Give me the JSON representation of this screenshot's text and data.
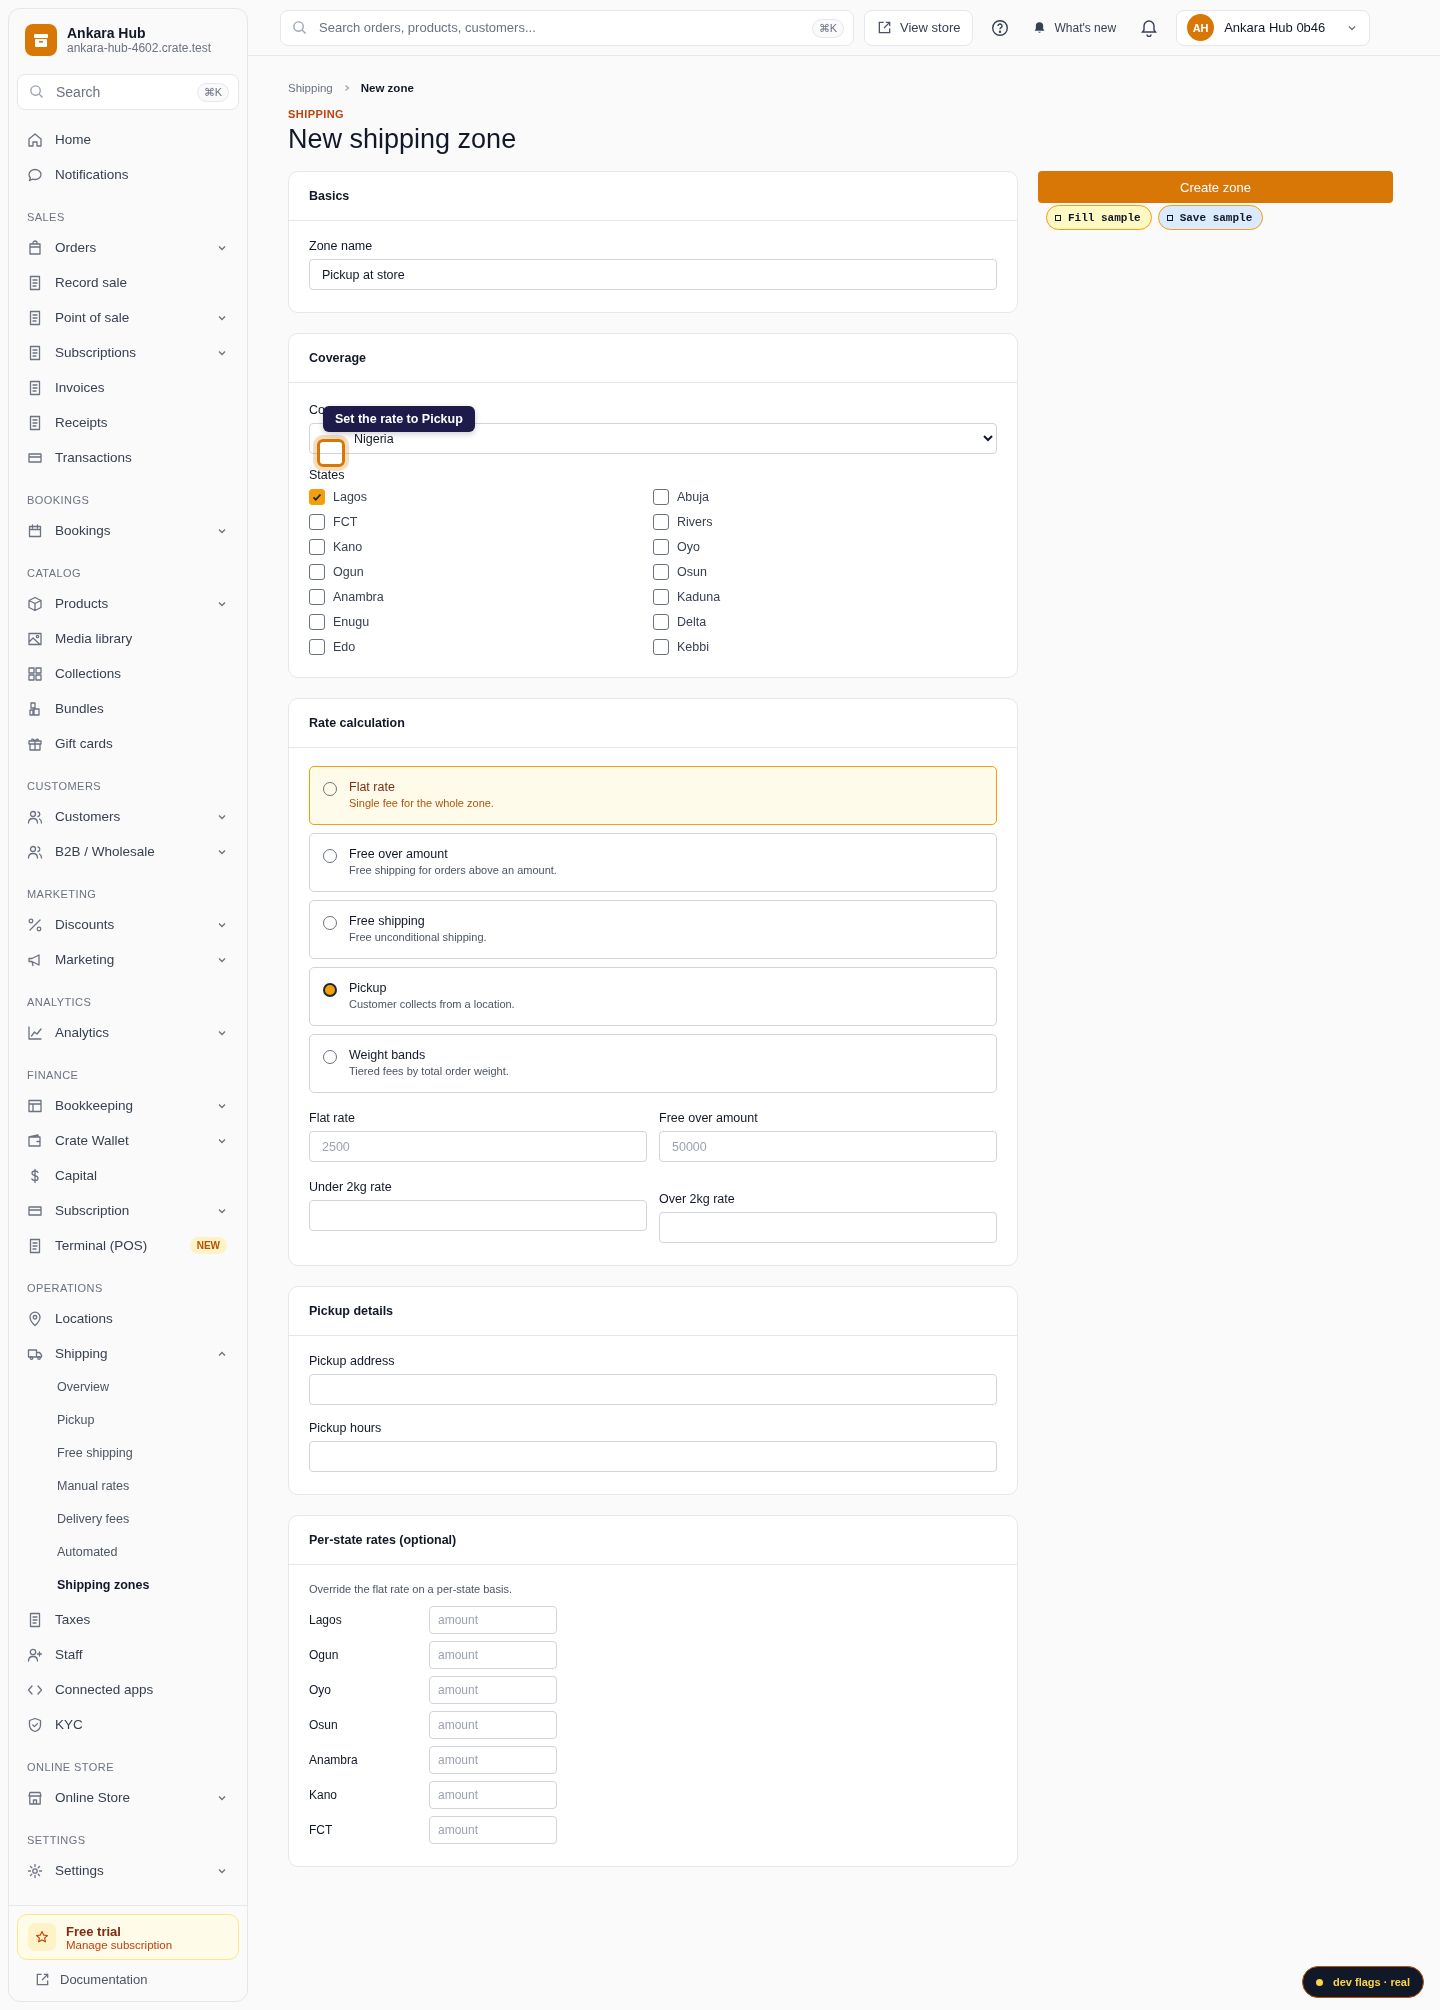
{
  "brand": {
    "name": "Ankara Hub",
    "domain": "ankara-hub-4602.crate.test"
  },
  "sidebar_search": {
    "placeholder": "Search",
    "shortcut": "⌘K"
  },
  "sidebar": {
    "sections": [
      {
        "items": [
          {
            "label": "Home",
            "expandable": false
          },
          {
            "label": "Notifications",
            "expandable": false
          }
        ]
      },
      {
        "title": "SALES",
        "items": [
          {
            "label": "Orders",
            "expandable": true
          },
          {
            "label": "Record sale",
            "expandable": false
          },
          {
            "label": "Point of sale",
            "expandable": true
          },
          {
            "label": "Subscriptions",
            "expandable": true
          },
          {
            "label": "Invoices",
            "expandable": false
          },
          {
            "label": "Receipts",
            "expandable": false
          },
          {
            "label": "Transactions",
            "expandable": false
          }
        ]
      },
      {
        "title": "BOOKINGS",
        "items": [
          {
            "label": "Bookings",
            "expandable": true
          }
        ]
      },
      {
        "title": "CATALOG",
        "items": [
          {
            "label": "Products",
            "expandable": true
          },
          {
            "label": "Media library",
            "expandable": false
          },
          {
            "label": "Collections",
            "expandable": false
          },
          {
            "label": "Bundles",
            "expandable": false
          },
          {
            "label": "Gift cards",
            "expandable": false
          }
        ]
      },
      {
        "title": "CUSTOMERS",
        "items": [
          {
            "label": "Customers",
            "expandable": true
          },
          {
            "label": "B2B / Wholesale",
            "expandable": true
          }
        ]
      },
      {
        "title": "MARKETING",
        "items": [
          {
            "label": "Discounts",
            "expandable": true
          },
          {
            "label": "Marketing",
            "expandable": true
          }
        ]
      },
      {
        "title": "ANALYTICS",
        "items": [
          {
            "label": "Analytics",
            "expandable": true
          }
        ]
      },
      {
        "title": "FINANCE",
        "items": [
          {
            "label": "Bookkeeping",
            "expandable": true
          },
          {
            "label": "Crate Wallet",
            "expandable": true
          },
          {
            "label": "Capital",
            "expandable": false
          },
          {
            "label": "Subscription",
            "expandable": true
          },
          {
            "label": "Terminal (POS)",
            "expandable": false,
            "badge": "NEW"
          }
        ]
      },
      {
        "title": "OPERATIONS",
        "items": [
          {
            "label": "Locations",
            "expandable": false
          },
          {
            "label": "Shipping",
            "expandable": true,
            "expanded": true,
            "children": [
              {
                "label": "Overview",
                "selected": false
              },
              {
                "label": "Pickup",
                "selected": false
              },
              {
                "label": "Free shipping",
                "selected": false
              },
              {
                "label": "Manual rates",
                "selected": false
              },
              {
                "label": "Delivery fees",
                "selected": false
              },
              {
                "label": "Automated",
                "selected": false
              },
              {
                "label": "Shipping zones",
                "selected": true
              }
            ]
          },
          {
            "label": "Taxes",
            "expandable": false
          },
          {
            "label": "Staff",
            "expandable": false
          },
          {
            "label": "Connected apps",
            "expandable": false
          },
          {
            "label": "KYC",
            "expandable": false
          }
        ]
      },
      {
        "title": "ONLINE STORE",
        "items": [
          {
            "label": "Online Store",
            "expandable": true
          }
        ]
      },
      {
        "title": "SETTINGS",
        "items": [
          {
            "label": "Settings",
            "expandable": true
          }
        ]
      }
    ]
  },
  "trial": {
    "title": "Free trial",
    "link": "Manage subscription"
  },
  "docs_link": "Documentation",
  "topbar": {
    "search_placeholder": "Search orders, products, customers...",
    "shortcut": "⌘K",
    "view_store": "View store",
    "whats_new": "What's new",
    "account": {
      "initials": "AH",
      "name": "Ankara Hub 0b46"
    }
  },
  "breadcrumbs": [
    "Shipping",
    "New zone"
  ],
  "eyebrow": "SHIPPING",
  "title": "New shipping zone",
  "basics": {
    "title": "Basics",
    "zone_name_label": "Zone name",
    "zone_name": "Pickup at store"
  },
  "coverage": {
    "title": "Coverage",
    "country_label": "Co",
    "country": "Nigeria",
    "states_label": "States",
    "states": [
      {
        "label": "Lagos",
        "checked": true
      },
      {
        "label": "Abuja",
        "checked": false
      },
      {
        "label": "FCT",
        "checked": false
      },
      {
        "label": "Rivers",
        "checked": false
      },
      {
        "label": "Kano",
        "checked": false
      },
      {
        "label": "Oyo",
        "checked": false
      },
      {
        "label": "Ogun",
        "checked": false
      },
      {
        "label": "Osun",
        "checked": false
      },
      {
        "label": "Anambra",
        "checked": false
      },
      {
        "label": "Kaduna",
        "checked": false
      },
      {
        "label": "Enugu",
        "checked": false
      },
      {
        "label": "Delta",
        "checked": false
      },
      {
        "label": "Edo",
        "checked": false
      },
      {
        "label": "Kebbi",
        "checked": false
      }
    ]
  },
  "tooltip": "Set the rate to Pickup",
  "rate_calculation": {
    "title": "Rate calculation",
    "options": [
      {
        "title": "Flat rate",
        "description": "Single fee for the whole zone.",
        "selected": false,
        "highlighted": true
      },
      {
        "title": "Free over amount",
        "description": "Free shipping for orders above an amount.",
        "selected": false,
        "highlighted": false
      },
      {
        "title": "Free shipping",
        "description": "Free unconditional shipping.",
        "selected": false,
        "highlighted": false
      },
      {
        "title": "Pickup",
        "description": "Customer collects from a location.",
        "selected": true,
        "highlighted": false
      },
      {
        "title": "Weight bands",
        "description": "Tiered fees by total order weight.",
        "selected": false,
        "highlighted": false
      }
    ],
    "fields": [
      {
        "label": "Flat rate",
        "placeholder": "2500"
      },
      {
        "label": "Free over amount",
        "placeholder": "50000"
      },
      {
        "label": "Under 2kg rate"
      },
      {
        "label": "Over 2kg rate"
      }
    ]
  },
  "pickup_details": {
    "title": "Pickup details",
    "fields": [
      {
        "label": "Pickup address"
      },
      {
        "label": "Pickup hours"
      }
    ]
  },
  "per_state_rates": {
    "title": "Per-state rates (optional)",
    "hint": "Override the flat rate on a per-state basis.",
    "rows": [
      {
        "state": "Lagos",
        "placeholder": "amount"
      },
      {
        "state": "Ogun",
        "placeholder": "amount"
      },
      {
        "state": "Oyo",
        "placeholder": "amount"
      },
      {
        "state": "Osun",
        "placeholder": "amount"
      },
      {
        "state": "Anambra",
        "placeholder": "amount"
      },
      {
        "state": "Kano",
        "placeholder": "amount"
      },
      {
        "state": "FCT",
        "placeholder": "amount"
      }
    ]
  },
  "actions": {
    "primary": "Create zone",
    "samples": [
      {
        "label": "Fill sample",
        "kind": "fill"
      },
      {
        "label": "Save sample",
        "kind": "save"
      }
    ]
  },
  "dev_flags": "dev flags · real"
}
